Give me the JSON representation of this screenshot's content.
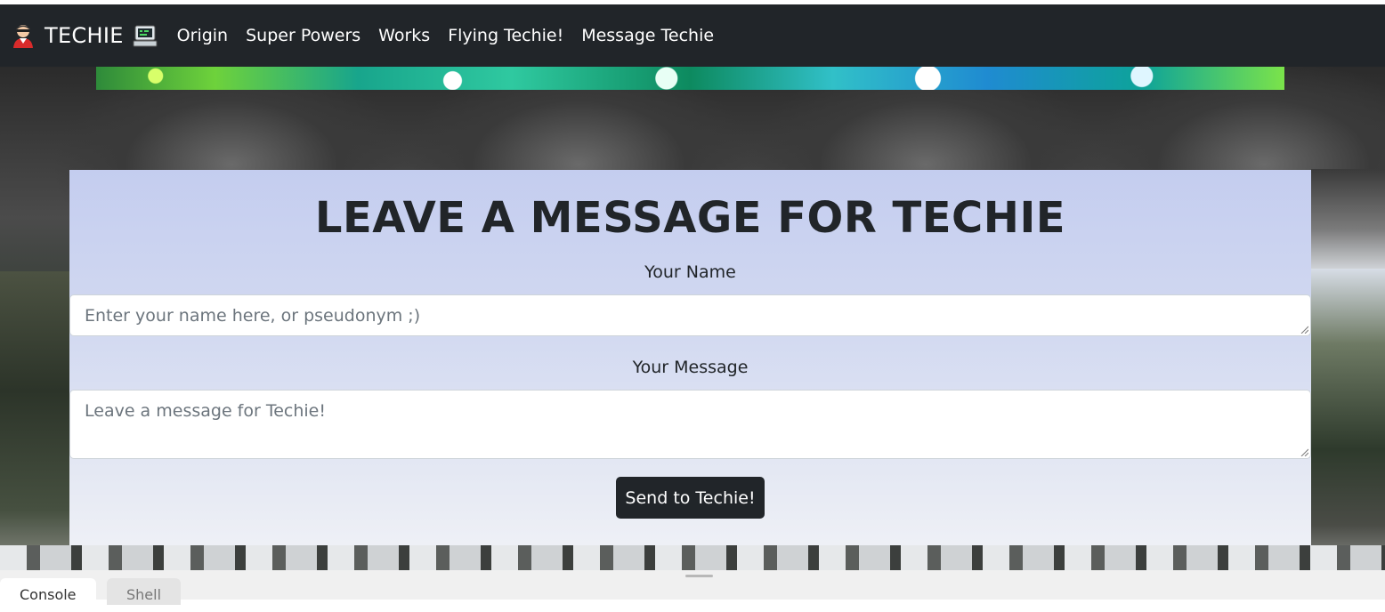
{
  "navbar": {
    "brand": "TECHIE",
    "links": [
      "Origin",
      "Super Powers",
      "Works",
      "Flying Techie!",
      "Message Techie"
    ]
  },
  "form": {
    "title": "LEAVE A MESSAGE FOR TECHIE",
    "name_label": "Your Name",
    "name_placeholder": "Enter your name here, or pseudonym ;)",
    "message_label": "Your Message",
    "message_placeholder": "Leave a message for Techie!",
    "submit_label": "Send to Techie!"
  },
  "devtools": {
    "tabs": [
      "Console",
      "Shell"
    ]
  },
  "colors": {
    "navbar_bg": "#212529",
    "button_bg": "#212529",
    "card_bg": "#d3daf1"
  },
  "icons": [
    "hacker-emoji-icon",
    "computer-emoji-icon"
  ]
}
